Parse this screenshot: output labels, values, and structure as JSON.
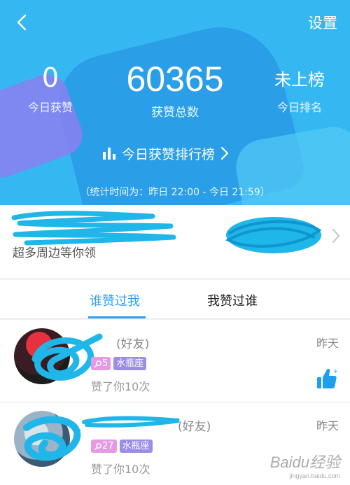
{
  "header": {
    "settings_label": "设置",
    "stats": {
      "today_likes": {
        "value": "0",
        "label": "今日获赞"
      },
      "total_likes": {
        "value": "60365",
        "label": "获赞总数"
      },
      "today_rank": {
        "value": "未上榜",
        "label": "今日排名"
      }
    },
    "rank_link_label": "今日获赞排行榜",
    "period_text": "（统计时间为：昨日 22:00 - 今日 21:59）"
  },
  "promo": {
    "text": "超多周边等你领"
  },
  "tabs": [
    {
      "label": "谁赞过我",
      "active": true
    },
    {
      "label": "我赞过谁",
      "active": false
    }
  ],
  "list": [
    {
      "name_suffix": "(好友)",
      "time": "昨天",
      "age": "5",
      "zodiac": "水瓶座",
      "likes_text": "赞了你10次"
    },
    {
      "name_suffix": "(好友)",
      "time": "昨天",
      "age": "27",
      "zodiac": "水瓶座",
      "likes_text": "赞了你10次"
    }
  ],
  "watermark": {
    "logo": "Baidu经验",
    "url": "jingyan.baidu.com"
  },
  "colors": {
    "header_bg": "#35b8f2",
    "accent": "#2f9ff2",
    "scribble": "#1fb6ea",
    "thumb": "#1d9ff0"
  }
}
